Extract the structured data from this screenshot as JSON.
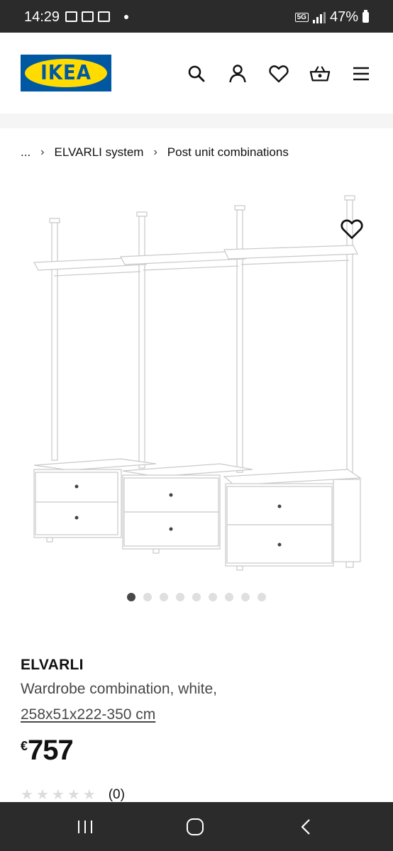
{
  "status_bar": {
    "time": "14:29",
    "network": "5G",
    "battery": "47%"
  },
  "header": {
    "logo_text": "IKEA",
    "icons": [
      "search-icon",
      "profile-icon",
      "heart-icon",
      "basket-icon",
      "menu-icon"
    ]
  },
  "breadcrumb": {
    "ellipsis": "...",
    "items": [
      "ELVARLI system",
      "Post unit combinations"
    ]
  },
  "gallery": {
    "image_count": 9,
    "active_index": 0
  },
  "product": {
    "name": "ELVARLI",
    "description": "Wardrobe combination, white,",
    "size": "258x51x222-350 cm",
    "price_currency": "€",
    "price_value": "757",
    "rating_count": "(0)",
    "rating_stars": 0
  },
  "colors": {
    "ikea_blue": "#0058a3",
    "ikea_yellow": "#ffdb00",
    "system_bar": "#2b2b2b"
  }
}
